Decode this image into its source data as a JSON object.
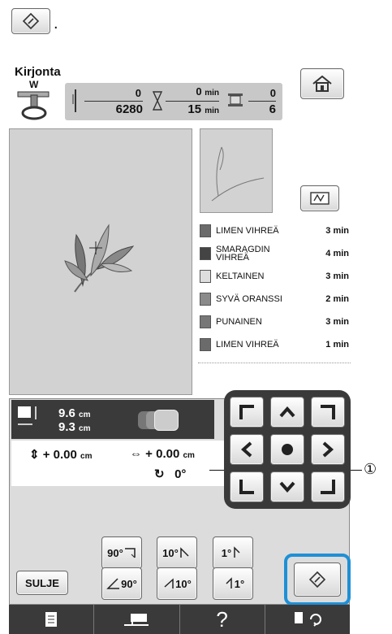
{
  "instruction": {
    "period": "."
  },
  "header": {
    "title": "Kirjonta",
    "presser_label": "W"
  },
  "counters": {
    "stitch_current": "0",
    "stitch_total": "6280",
    "time_current": "0",
    "time_total": "15",
    "time_unit": "min",
    "color_current": "0",
    "color_total": "6"
  },
  "threads": [
    {
      "name": "LIMEN VIHREÄ",
      "time": "3 min",
      "color": "#6b6b6b"
    },
    {
      "name": "SMARAGDIN VIHREÄ",
      "time": "4 min",
      "color": "#444444"
    },
    {
      "name": "KELTAINEN",
      "time": "3 min",
      "color": "#c4c4c4"
    },
    {
      "name": "SYVÄ ORANSSI",
      "time": "2 min",
      "color": "#8a8a8a"
    },
    {
      "name": "PUNAINEN",
      "time": "3 min",
      "color": "#777777"
    },
    {
      "name": "LIMEN VIHREÄ",
      "time": "1 min",
      "color": "#6b6b6b"
    }
  ],
  "size": {
    "width": "9.6",
    "height": "9.3",
    "unit": "cm"
  },
  "offset": {
    "vertical": "+ 0.00",
    "horizontal": "+ 0.00",
    "unit": "cm"
  },
  "rotation": {
    "value": "0",
    "unit": "°"
  },
  "rotate_buttons": {
    "r90": "90°",
    "r10": "10°",
    "r1": "1°",
    "l90": "90°",
    "l10": "10°",
    "l1": "1°"
  },
  "close_label": "SULJE",
  "callout": "①",
  "bottom_help": "?",
  "colors": {
    "highlight": "#1e90d6",
    "panel": "#dcdcdc",
    "canvas": "#d2d2d2",
    "bar": "#3a3a3a"
  }
}
